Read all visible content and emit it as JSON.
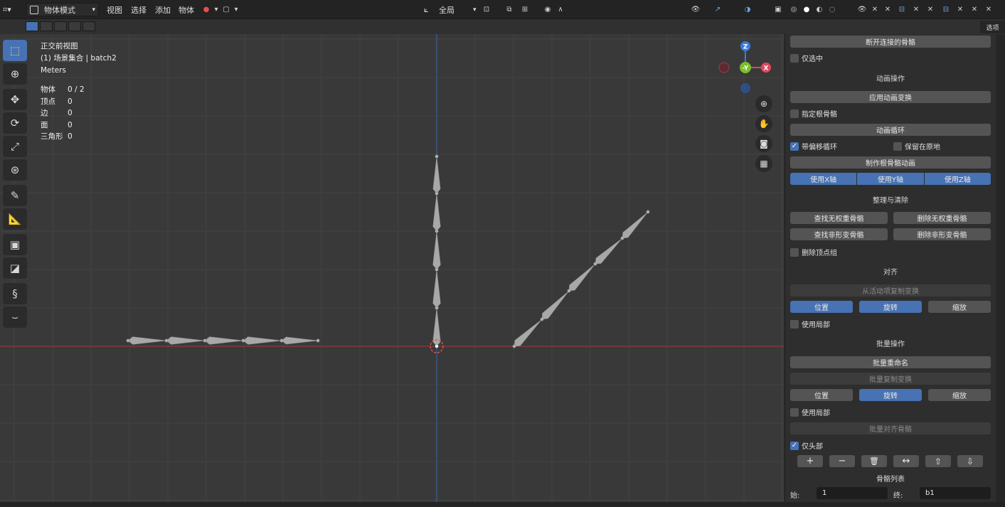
{
  "header": {
    "mode_label": "物体模式",
    "menu": [
      "视图",
      "选择",
      "添加",
      "物体"
    ],
    "transform_orientation": "全局",
    "sidebar_tab": "选项"
  },
  "overlay": {
    "view_name": "正交前视图",
    "collection": "(1) 场景集合 | batch2",
    "units": "Meters"
  },
  "stats": [
    {
      "label": "物体",
      "value": "0 / 2"
    },
    {
      "label": "顶点",
      "value": "0"
    },
    {
      "label": "边",
      "value": "0"
    },
    {
      "label": "面",
      "value": "0"
    },
    {
      "label": "三角形",
      "value": "0"
    }
  ],
  "gizmo": {
    "z": "Z",
    "y": "-Y",
    "x": "X"
  },
  "panel": {
    "disconnect_bones": "断开连接的骨骼",
    "only_selected": "仅选中",
    "section_anim": "动画操作",
    "apply_anim_transform": "应用动画变换",
    "assign_root_bone": "指定根骨骼",
    "anim_loop": "动画循环",
    "loop_with_offset": "带偏移循环",
    "keep_in_place": "保留在原地",
    "make_root_anim": "制作根骨骼动画",
    "use_x": "使用X轴",
    "use_y": "使用Y轴",
    "use_z": "使用Z轴",
    "section_cleanup": "整理与清除",
    "find_no_weight": "查找无权重骨骼",
    "delete_no_weight": "删除无权重骨骼",
    "find_non_deform": "查找非形变骨骼",
    "delete_non_deform": "删除非形变骨骼",
    "delete_vertex_groups": "删除顶点组",
    "section_align": "对齐",
    "copy_from_active": "从活动项复制变换",
    "loc1": "位置",
    "rot1": "旋转",
    "scale1": "缩放",
    "use_local1": "使用局部",
    "section_batch": "批量操作",
    "batch_rename": "批量重命名",
    "batch_copy_transform": "批量复制变换",
    "loc2": "位置",
    "rot2": "旋转",
    "scale2": "缩放",
    "use_local2": "使用局部",
    "batch_align_bones": "批量对齐骨骼",
    "heads_only": "仅头部",
    "bone_list": "骨骼列表",
    "start_label": "始:",
    "start_value": "1",
    "end_label": "终:",
    "end_value": "b1"
  }
}
